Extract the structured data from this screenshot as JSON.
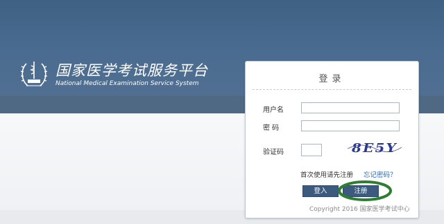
{
  "brand": {
    "title_cn": "国家医学考试服务平台",
    "title_en": "National Medical Examination Service System"
  },
  "login": {
    "title": "登录",
    "username_label": "用户名",
    "password_label": "密 码",
    "captcha_label": "验证码",
    "captcha_text": "8E5Y",
    "hint": "首次使用请先注册",
    "forgot_link": "忘记密码？",
    "login_button": "登入",
    "register_button": "注册",
    "copyright": "Copyright 2016 国家医学考试中心"
  },
  "colors": {
    "banner": "#4a6c90",
    "button": "#3b5a7d",
    "highlight_ring": "#2f7d32",
    "link": "#2b6cb0"
  }
}
